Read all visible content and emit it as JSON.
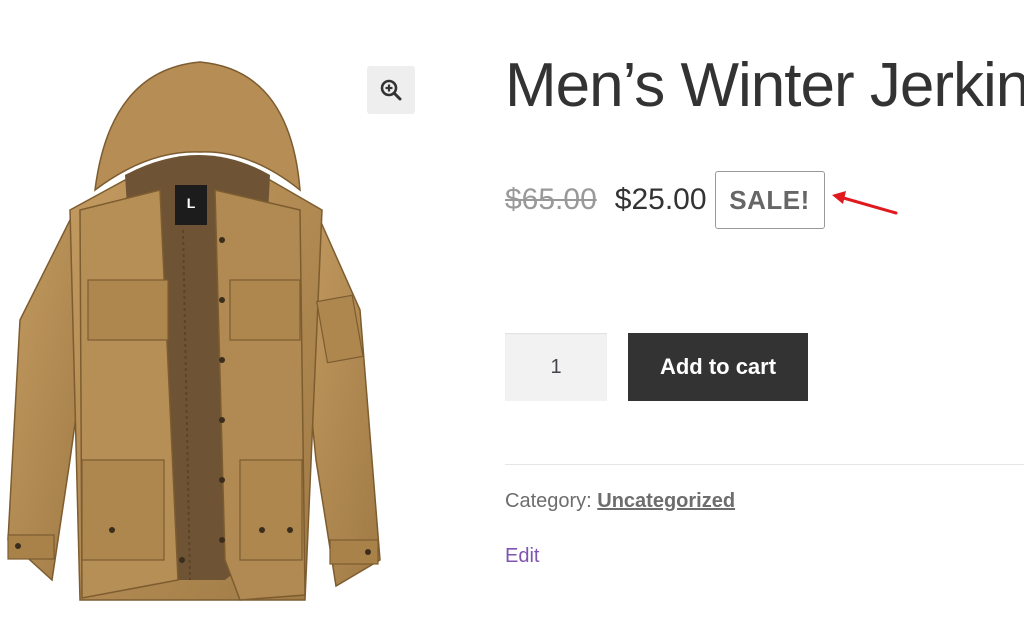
{
  "colors": {
    "text": "#333333",
    "muted": "#999999",
    "button_bg": "#333333",
    "button_text": "#ffffff",
    "link_edit": "#7f54b3",
    "annotation": "#e0191e",
    "jacket": "#b08a52"
  },
  "gallery": {
    "image_alt": "jacket-product-image",
    "zoom_icon": "zoom-in-icon",
    "label_tag": "L"
  },
  "product": {
    "title": "Men’s Winter Jerkins",
    "price_old": "$65.00",
    "price_new": "$25.00",
    "sale_badge": "SALE!",
    "quantity": "1",
    "add_to_cart": "Add to cart",
    "category_label": "Category: ",
    "category_value": "Uncategorized",
    "edit": "Edit"
  },
  "annotation": {
    "icon": "red-arrow-icon"
  }
}
